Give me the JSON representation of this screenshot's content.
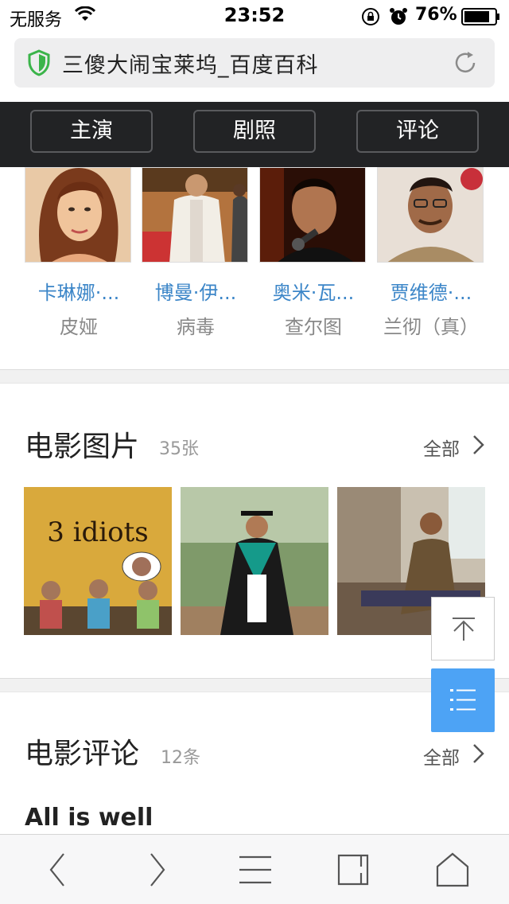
{
  "status_bar": {
    "carrier": "无服务",
    "time": "23:52",
    "battery": "76%",
    "icons": [
      "wifi-icon",
      "orientation-lock-icon",
      "alarm-icon",
      "battery-icon"
    ]
  },
  "address_bar": {
    "title": "三傻大闹宝莱坞_百度百科",
    "icons": [
      "shield-icon",
      "reload-icon"
    ],
    "accent_color": "#3bb44a"
  },
  "tabs": [
    {
      "label": "主演"
    },
    {
      "label": "剧照"
    },
    {
      "label": "评论"
    }
  ],
  "cast": [
    {
      "name": "卡琳娜·...",
      "role": "皮娅"
    },
    {
      "name": "博曼·伊...",
      "role": "病毒"
    },
    {
      "name": "奥米·瓦...",
      "role": "查尔图"
    },
    {
      "name": "贾维德·...",
      "role": "兰彻（真）"
    }
  ],
  "photos_section": {
    "title": "电影图片",
    "count": "35张",
    "more": "全部",
    "poster_text": "3 idiots"
  },
  "reviews_section": {
    "title": "电影评论",
    "count": "12条",
    "more": "全部",
    "first_review_title": "All is well"
  },
  "floating": {
    "catalog_color": "#4da3f5"
  },
  "toolbar": {
    "icons": [
      "back-icon",
      "forward-icon",
      "menu-icon",
      "tabs-icon",
      "home-icon"
    ]
  },
  "colors": {
    "link": "#3c86c8",
    "tab_bar_bg": "#222325"
  }
}
